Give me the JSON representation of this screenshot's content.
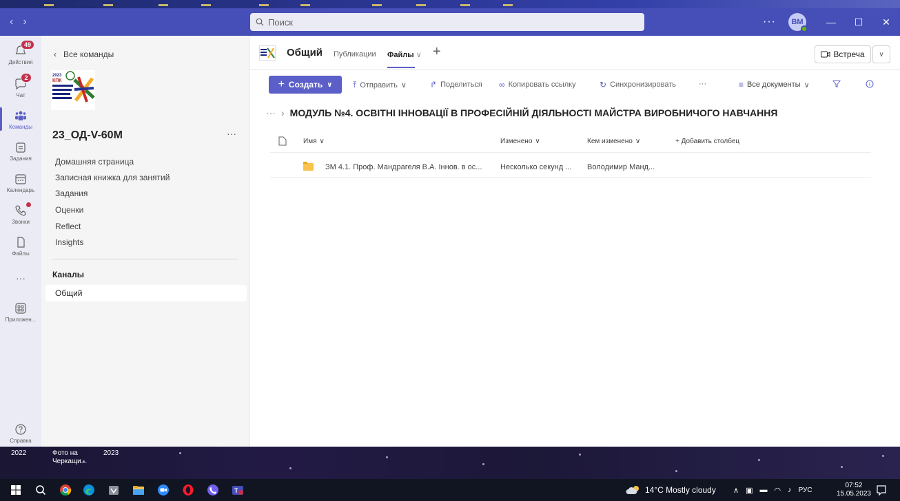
{
  "titlebar": {
    "search_placeholder": "Поиск",
    "more": "···",
    "avatar_initials": "BM",
    "minimize": "—",
    "maximize": "☐",
    "close": "✕"
  },
  "rail": {
    "items": [
      {
        "label": "Действия",
        "badge": "49"
      },
      {
        "label": "Чат",
        "badge": "2"
      },
      {
        "label": "Команды"
      },
      {
        "label": "Задания"
      },
      {
        "label": "Календарь"
      },
      {
        "label": "Звонки"
      },
      {
        "label": "Файлы"
      },
      {
        "label": "Приложен..."
      },
      {
        "label": "Справка"
      }
    ],
    "more": "···"
  },
  "teampane": {
    "all_teams": "Все команды",
    "team_name": "23_ОД-V-60М",
    "team_more": "···",
    "links": [
      "Домашняя страница",
      "Записная книжка для занятий",
      "Задания",
      "Оценки",
      "Reflect",
      "Insights"
    ],
    "channels_header": "Каналы",
    "channel_selected": "Общий"
  },
  "main": {
    "channel_title": "Общий",
    "tabs": [
      "Публикации",
      "Файлы"
    ],
    "meet_label": "Встреча",
    "toolbar": {
      "create": "Создать",
      "send": "Отправить",
      "share": "Поделиться",
      "copy_link": "Копировать ссылку",
      "sync": "Синхронизировать",
      "more": "···",
      "all_docs": "Все документы"
    },
    "breadcrumb_more": "···",
    "breadcrumb_title": "МОДУЛЬ №4. ОСВІТНІ ІННОВАЦІЇ В ПРОФЕСІЙНІЙ ДІЯЛЬНОСТІ МАЙСТРА ВИРОБНИЧОГО НАВЧАННЯ",
    "columns": {
      "name": "Имя",
      "modified": "Изменено",
      "modified_by": "Кем изменено",
      "add_column": "+ Добавить столбец"
    },
    "rows": [
      {
        "name": "ЗМ 4.1. Проф. Мандрагеля В.А. Іннов. в ос...",
        "modified": "Несколько секунд ...",
        "modified_by": "Володимир Манд..."
      }
    ]
  },
  "desktop": {
    "items": [
      "2022",
      "Фото на Черкащи...",
      "2023"
    ]
  },
  "taskbar": {
    "weather": "14°C Mostly cloudy",
    "lang": "РУС",
    "time": "07:52",
    "date": "15.05.2023"
  },
  "colors": {
    "titlebar": "#464eb8",
    "accent": "#5b5fc7",
    "badge": "#c4314b"
  }
}
